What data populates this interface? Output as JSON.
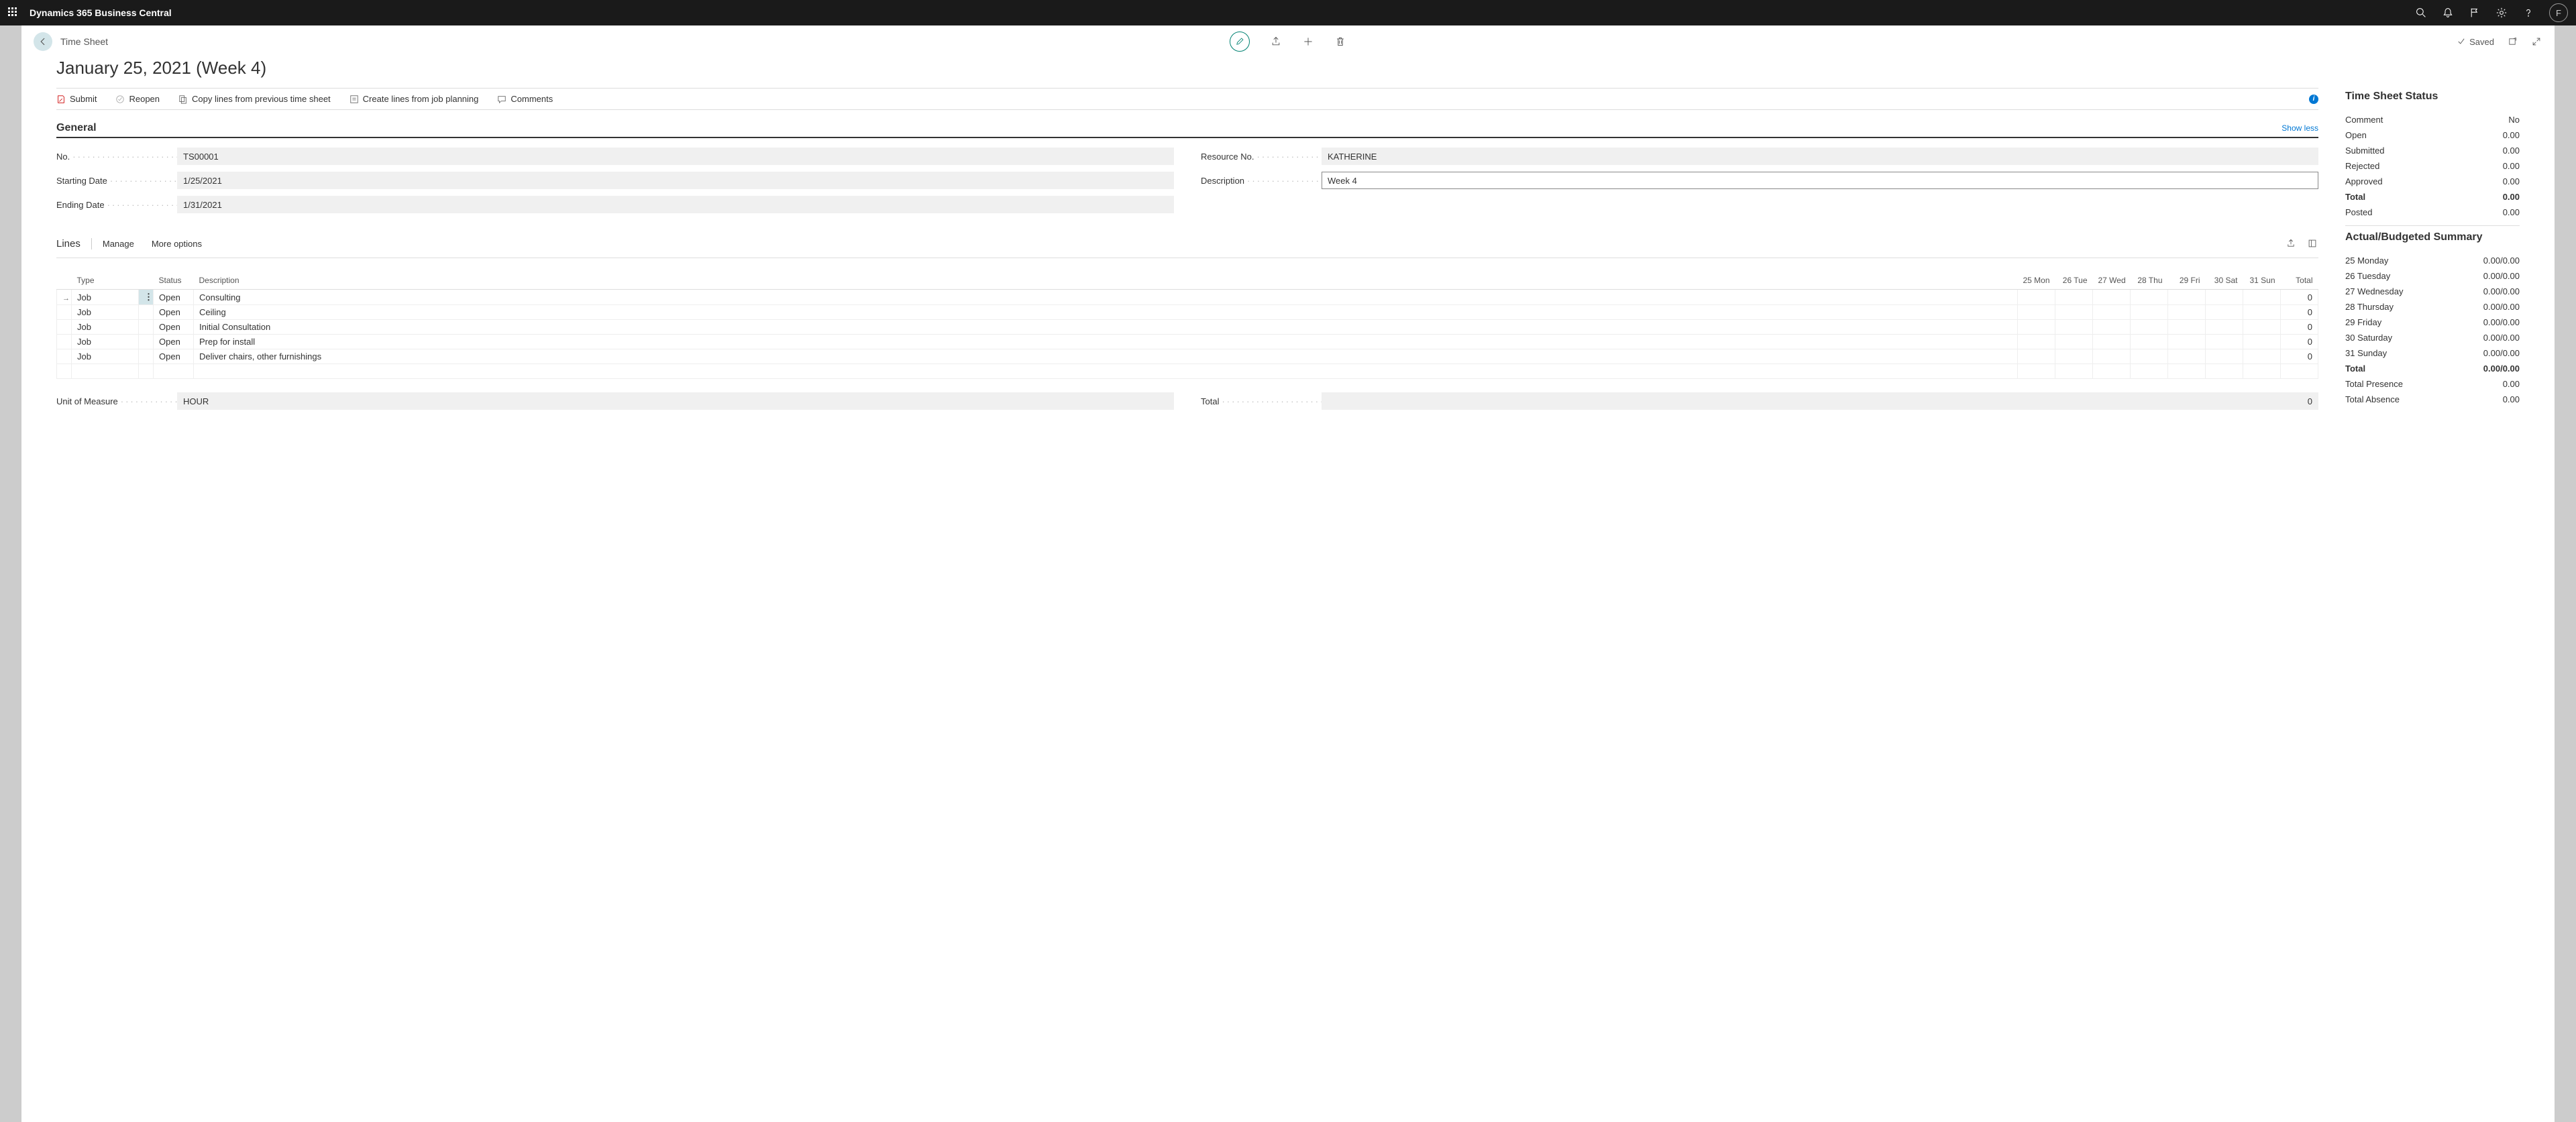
{
  "topbar": {
    "title": "Dynamics 365 Business Central",
    "avatar": "F"
  },
  "page": {
    "crumb": "Time Sheet",
    "title": "January 25, 2021 (Week 4)",
    "saved_label": "Saved"
  },
  "actions": {
    "submit": "Submit",
    "reopen": "Reopen",
    "copy": "Copy lines from previous time sheet",
    "create": "Create lines from job planning",
    "comments": "Comments"
  },
  "general": {
    "title": "General",
    "show_less": "Show less",
    "labels": {
      "no": "No.",
      "starting": "Starting Date",
      "ending": "Ending Date",
      "resource": "Resource No.",
      "description": "Description"
    },
    "no": "TS00001",
    "starting_date": "1/25/2021",
    "ending_date": "1/31/2021",
    "resource_no": "KATHERINE",
    "description": "Week 4"
  },
  "lines": {
    "title": "Lines",
    "manage": "Manage",
    "more": "More options",
    "columns": {
      "type": "Type",
      "status": "Status",
      "description": "Description",
      "d1": "25 Mon",
      "d2": "26 Tue",
      "d3": "27 Wed",
      "d4": "28 Thu",
      "d5": "29 Fri",
      "d6": "30 Sat",
      "d7": "31 Sun",
      "total": "Total"
    },
    "rows": [
      {
        "type": "Job",
        "status": "Open",
        "description": "Consulting",
        "total": "0"
      },
      {
        "type": "Job",
        "status": "Open",
        "description": "Ceiling",
        "total": "0"
      },
      {
        "type": "Job",
        "status": "Open",
        "description": "Initial Consultation",
        "total": "0"
      },
      {
        "type": "Job",
        "status": "Open",
        "description": "Prep for install",
        "total": "0"
      },
      {
        "type": "Job",
        "status": "Open",
        "description": "Deliver chairs, other furnishings",
        "total": "0"
      }
    ],
    "footer": {
      "uom_label": "Unit of Measure",
      "uom": "HOUR",
      "total_label": "Total",
      "total": "0"
    }
  },
  "status": {
    "title": "Time Sheet Status",
    "rows": [
      {
        "label": "Comment",
        "value": "No"
      },
      {
        "label": "Open",
        "value": "0.00"
      },
      {
        "label": "Submitted",
        "value": "0.00"
      },
      {
        "label": "Rejected",
        "value": "0.00"
      },
      {
        "label": "Approved",
        "value": "0.00"
      },
      {
        "label": "Total",
        "value": "0.00",
        "bold": true
      },
      {
        "label": "Posted",
        "value": "0.00"
      }
    ]
  },
  "summary": {
    "title": "Actual/Budgeted Summary",
    "rows": [
      {
        "label": "25 Monday",
        "value": "0.00/0.00"
      },
      {
        "label": "26 Tuesday",
        "value": "0.00/0.00"
      },
      {
        "label": "27 Wednesday",
        "value": "0.00/0.00"
      },
      {
        "label": "28 Thursday",
        "value": "0.00/0.00"
      },
      {
        "label": "29 Friday",
        "value": "0.00/0.00"
      },
      {
        "label": "30 Saturday",
        "value": "0.00/0.00"
      },
      {
        "label": "31 Sunday",
        "value": "0.00/0.00"
      },
      {
        "label": "Total",
        "value": "0.00/0.00",
        "bold": true
      },
      {
        "label": "Total Presence",
        "value": "0.00"
      },
      {
        "label": "Total Absence",
        "value": "0.00"
      }
    ]
  }
}
